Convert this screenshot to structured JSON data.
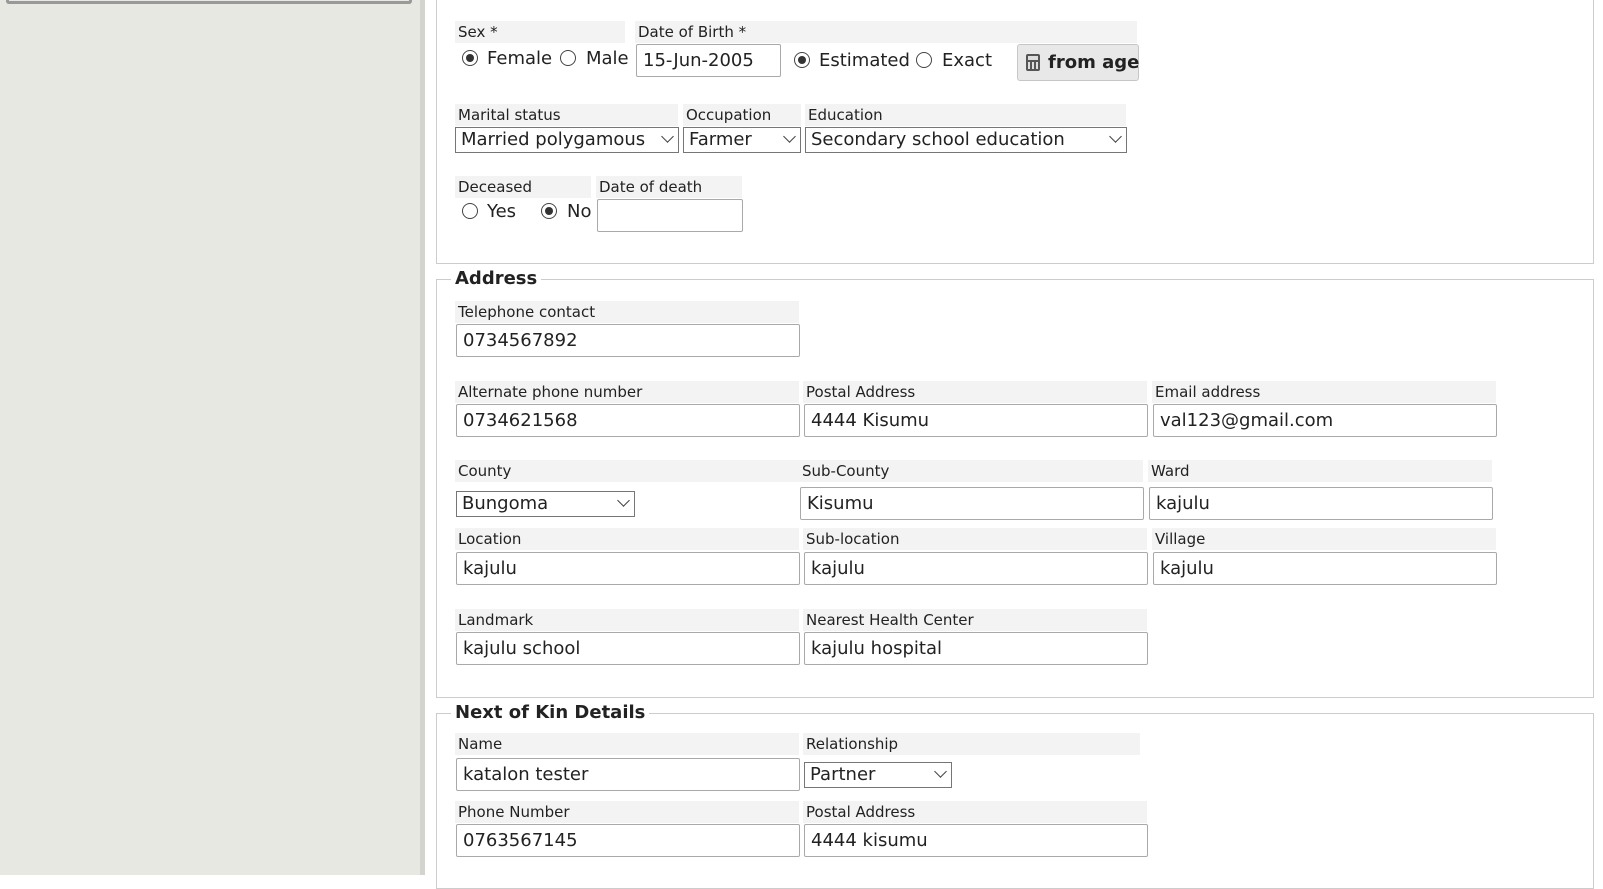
{
  "demographics": {
    "sex": {
      "label": "Sex *",
      "options": [
        "Female",
        "Male"
      ],
      "selected": "Female"
    },
    "dob": {
      "label": "Date of Birth *",
      "value": "15-Jun-2005",
      "options": [
        "Estimated",
        "Exact"
      ],
      "selected": "Estimated",
      "from_age_label": "from age"
    },
    "marital_status": {
      "label": "Marital status",
      "value": "Married polygamous"
    },
    "occupation": {
      "label": "Occupation",
      "value": "Farmer"
    },
    "education": {
      "label": "Education",
      "value": "Secondary school education"
    },
    "deceased": {
      "label": "Deceased",
      "options": [
        "Yes",
        "No"
      ],
      "selected": "No"
    },
    "date_of_death": {
      "label": "Date of death",
      "value": ""
    }
  },
  "address": {
    "legend": "Address",
    "telephone": {
      "label": "Telephone contact",
      "value": "0734567892"
    },
    "alt_phone": {
      "label": "Alternate phone number",
      "value": "0734621568"
    },
    "postal": {
      "label": "Postal Address",
      "value": "4444 Kisumu"
    },
    "email": {
      "label": "Email address",
      "value": "val123@gmail.com"
    },
    "county": {
      "label": "County",
      "value": "Bungoma"
    },
    "sub_county": {
      "label": "Sub-County",
      "value": "Kisumu"
    },
    "ward": {
      "label": "Ward",
      "value": "kajulu"
    },
    "location": {
      "label": "Location",
      "value": "kajulu"
    },
    "sub_location": {
      "label": "Sub-location",
      "value": "kajulu"
    },
    "village": {
      "label": "Village",
      "value": "kajulu"
    },
    "landmark": {
      "label": "Landmark",
      "value": "kajulu school"
    },
    "health_center": {
      "label": "Nearest Health Center",
      "value": "kajulu hospital"
    }
  },
  "next_of_kin": {
    "legend": "Next of Kin Details",
    "name": {
      "label": "Name",
      "value": "katalon tester"
    },
    "relationship": {
      "label": "Relationship",
      "value": "Partner"
    },
    "phone": {
      "label": "Phone Number",
      "value": "0763567145"
    },
    "postal": {
      "label": "Postal Address",
      "value": "4444 kisumu"
    }
  }
}
